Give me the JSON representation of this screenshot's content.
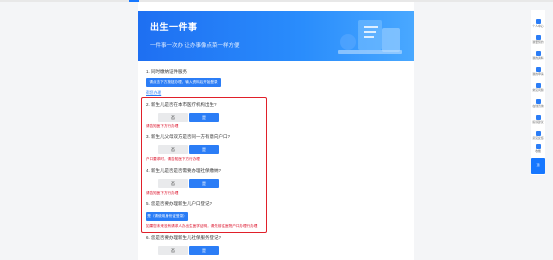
{
  "banner": {
    "title": "出生一件事",
    "subtitle": "一件事一次办    让办事像点菜一样方便"
  },
  "questions": [
    {
      "label": "1. 同时缴纳证件服务",
      "action": "请点击下方按钮办理，输入资料后开始登录"
    },
    {
      "label": "2. 新生儿是否在本市医疗机构出生?",
      "no": "否",
      "yes": "是",
      "warning": "请告知医下方行办理"
    },
    {
      "label": "3. 新生儿父母双方是否同一方有意向户口?",
      "no": "否",
      "yes": "是",
      "warning": "户口要求时，请告知医下方行办理"
    },
    {
      "label": "4. 新生儿是否是否需要办理社保缴纳?",
      "no": "否",
      "yes": "是",
      "warning": "请告知医下方行办理"
    },
    {
      "label": "5. 您是否要办理新生儿户口登记?",
      "action": "是（请使用身份证登录）",
      "warning": "如果您未来没有请求人办出生医学证明，请先前往医院户口办理行办理"
    },
    {
      "label": "6. 您是否要办理新生儿社保服务登记?",
      "no": "否",
      "yes": "是"
    }
  ],
  "link": "帮您办理",
  "sidebar": {
    "items": [
      "个人中心",
      "我要预约",
      "我的资料",
      "我的申请",
      "常见问题",
      "在线咨询",
      "投诉建议",
      "意见反馈",
      "收藏"
    ],
    "top": "顶"
  }
}
